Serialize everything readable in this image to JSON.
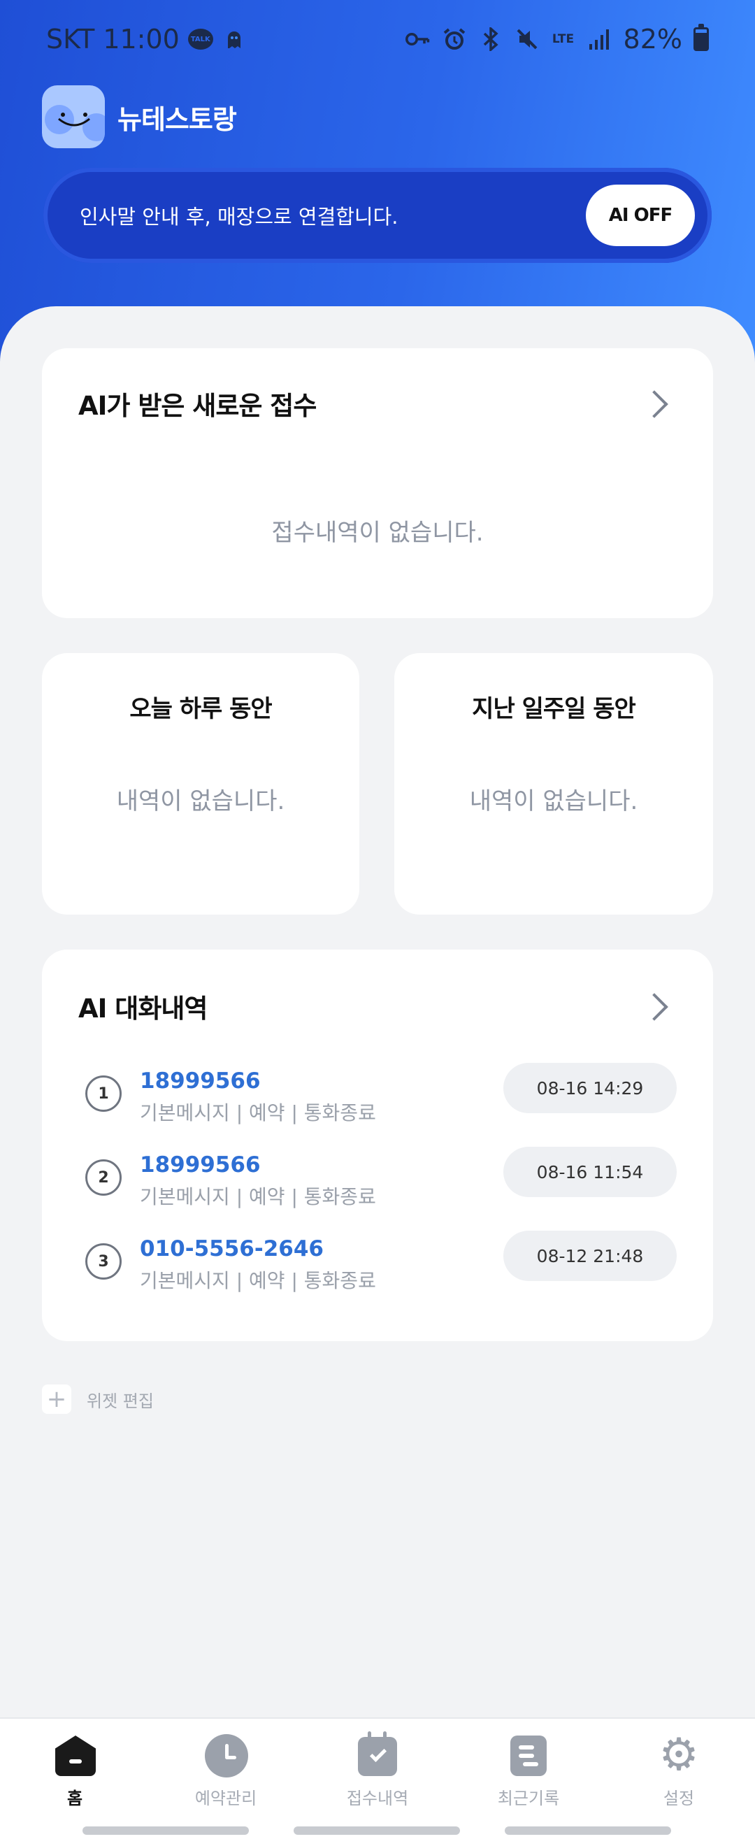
{
  "status_bar": {
    "carrier": "SKT",
    "time": "11:00",
    "talk_icon_text": "TALK",
    "network_type": "LTE",
    "battery_percent": "82%",
    "battery_level": 0.82
  },
  "header": {
    "app_name": "뉴테스토랑",
    "banner_text": "인사말 안내 후, 매장으로 연결합니다.",
    "ai_toggle_label": "AI OFF"
  },
  "new_requests": {
    "title": "AI가 받은 새로운 접수",
    "empty_text": "접수내역이 없습니다."
  },
  "stats": {
    "today": {
      "title": "오늘 하루 동안",
      "empty_text": "내역이 없습니다."
    },
    "week": {
      "title": "지난 일주일 동안",
      "empty_text": "내역이 없습니다."
    }
  },
  "conversations": {
    "title": "AI 대화내역",
    "items": [
      {
        "rank": "1",
        "phone": "18999566",
        "meta": "기본메시지 | 예약 | 통화종료",
        "time": "08-16 14:29"
      },
      {
        "rank": "2",
        "phone": "18999566",
        "meta": "기본메시지 | 예약 | 통화종료",
        "time": "08-16 11:54"
      },
      {
        "rank": "3",
        "phone": "010-5556-2646",
        "meta": "기본메시지 | 예약 | 통화종료",
        "time": "08-12 21:48"
      }
    ]
  },
  "widget_edit": {
    "plus": "+",
    "label": "위젯 편집"
  },
  "tabbar": {
    "items": [
      {
        "label": "홈",
        "icon": "home-icon",
        "active": true
      },
      {
        "label": "예약관리",
        "icon": "clock-icon",
        "active": false
      },
      {
        "label": "접수내역",
        "icon": "calendar-check-icon",
        "active": false
      },
      {
        "label": "최근기록",
        "icon": "document-icon",
        "active": false
      },
      {
        "label": "설정",
        "icon": "gear-icon",
        "active": false
      }
    ]
  },
  "colors": {
    "brand_blue": "#2b66ea",
    "link_blue": "#2e6fd4",
    "background": "#f2f3f5"
  }
}
